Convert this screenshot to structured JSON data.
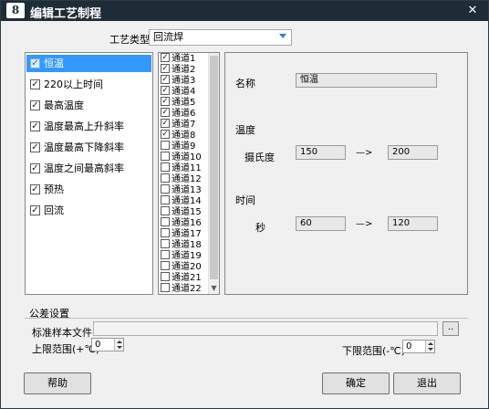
{
  "window": {
    "title": "编辑工艺制程",
    "app_icon_glyph": "8",
    "close_glyph": "✕"
  },
  "process_type": {
    "label": "工艺类型",
    "value": "回流焊"
  },
  "left_list": [
    {
      "label": "恒温",
      "checked": true,
      "selected": true
    },
    {
      "label": "220以上时间",
      "checked": true,
      "selected": false
    },
    {
      "label": "最高温度",
      "checked": true,
      "selected": false
    },
    {
      "label": "温度最高上升斜率",
      "checked": true,
      "selected": false
    },
    {
      "label": "温度最高下降斜率",
      "checked": true,
      "selected": false
    },
    {
      "label": "温度之间最高斜率",
      "checked": true,
      "selected": false
    },
    {
      "label": "预热",
      "checked": true,
      "selected": false
    },
    {
      "label": "回流",
      "checked": true,
      "selected": false
    }
  ],
  "channels": [
    {
      "label": "通道1",
      "checked": true
    },
    {
      "label": "通道2",
      "checked": true
    },
    {
      "label": "通道3",
      "checked": true
    },
    {
      "label": "通道4",
      "checked": true
    },
    {
      "label": "通道5",
      "checked": true
    },
    {
      "label": "通道6",
      "checked": true
    },
    {
      "label": "通道7",
      "checked": true
    },
    {
      "label": "通道8",
      "checked": true
    },
    {
      "label": "通道9",
      "checked": false
    },
    {
      "label": "通道10",
      "checked": false
    },
    {
      "label": "通道11",
      "checked": false
    },
    {
      "label": "通道12",
      "checked": false
    },
    {
      "label": "通道13",
      "checked": false
    },
    {
      "label": "通道14",
      "checked": false
    },
    {
      "label": "通道15",
      "checked": false
    },
    {
      "label": "通道16",
      "checked": false
    },
    {
      "label": "通道17",
      "checked": false
    },
    {
      "label": "通道18",
      "checked": false
    },
    {
      "label": "通道19",
      "checked": false
    },
    {
      "label": "通道20",
      "checked": false
    },
    {
      "label": "通道21",
      "checked": false
    },
    {
      "label": "通道22",
      "checked": false
    }
  ],
  "details": {
    "name_label": "名称",
    "name_value": "恒温",
    "temp_section": "温度",
    "temp_unit_label": "摄氏度",
    "temp_from": "150",
    "temp_arrow": "—>",
    "temp_to": "200",
    "time_section": "时间",
    "time_unit_label": "秒",
    "time_from": "60",
    "time_arrow": "—>",
    "time_to": "120"
  },
  "tolerance": {
    "section_label": "公差设置",
    "file_label": "标准样本文件",
    "file_value": "",
    "browse_label": "..",
    "upper_label": "上限范围(+℃)",
    "upper_value": "0",
    "lower_label": "下限范围(-℃)",
    "lower_value": "0"
  },
  "buttons": {
    "help": "帮助",
    "ok": "确定",
    "exit": "退出"
  }
}
